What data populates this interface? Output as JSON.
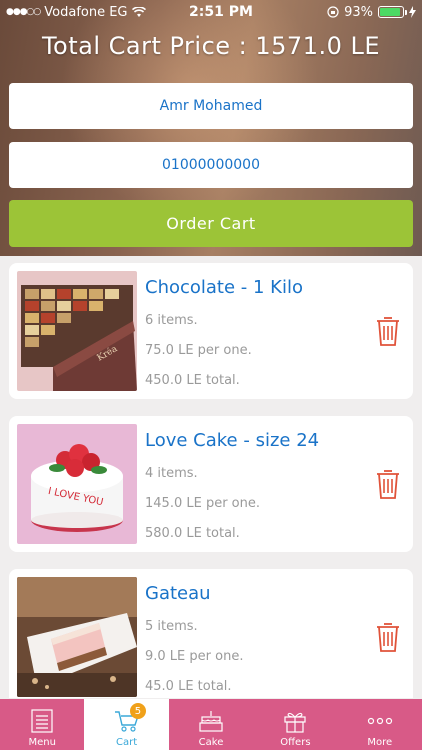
{
  "status": {
    "carrier": "Vodafone EG",
    "time": "2:51 PM",
    "battery": "93%",
    "battery_level": 0.93
  },
  "header": {
    "total_title": "Total Cart Price : 1571.0 LE",
    "name_value": "Amr Mohamed",
    "phone_value": "01000000000",
    "order_label": "Order Cart"
  },
  "cart": {
    "items": [
      {
        "title": "Chocolate - 1 Kilo",
        "count": "6 items.",
        "price": "75.0 LE per one.",
        "total": "450.0 LE total.",
        "image": "chocolate-box"
      },
      {
        "title": "Love Cake - size 24",
        "count": "4 items.",
        "price": "145.0 LE per one.",
        "total": "580.0 LE total.",
        "image": "love-cake"
      },
      {
        "title": "Gateau",
        "count": "5 items.",
        "price": "9.0 LE per one.",
        "total": "45.0 LE total.",
        "image": "gateau-slice"
      }
    ]
  },
  "tabs": {
    "menu": "Menu",
    "cart": "Cart",
    "cart_badge": "5",
    "cake": "Cake",
    "offers": "Offers",
    "more": "More"
  },
  "colors": {
    "accent_blue": "#1a73c8",
    "order_green": "#9cc437",
    "tabbar_pink": "#d85a87",
    "trash_red": "#e0533a"
  }
}
